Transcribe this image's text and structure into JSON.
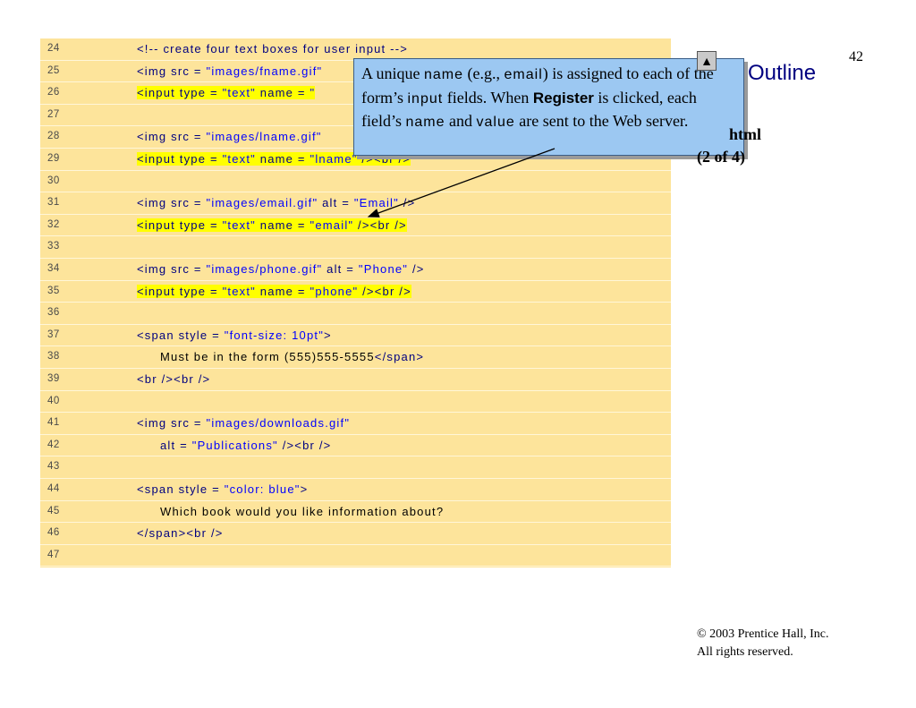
{
  "slide": {
    "number": "42",
    "outline_label": "Outline",
    "nav_up_label": "▲",
    "file_name": "html",
    "file_part": "(2 of 4)",
    "copyright_line1": "©  2003 Prentice Hall, Inc.",
    "copyright_line2": "All rights reserved."
  },
  "callout": {
    "t1": "A unique ",
    "m1": "name",
    "t2": " (e.g., ",
    "m2": "email",
    "t3": ") is assigned to each of the form’s ",
    "m3": "input",
    "t4": " fields. When ",
    "b1": "Register",
    "t5": " is clicked, each field’s ",
    "m4": "name",
    "t6": " and ",
    "m5": "value",
    "t7": " are sent to the Web server."
  },
  "code_lines": [
    {
      "num": "24",
      "indent": 2,
      "hl": false,
      "parts": [
        {
          "t": "<!-- create four text boxes for user input -->",
          "c": ""
        }
      ]
    },
    {
      "num": "25",
      "indent": 2,
      "hl": false,
      "parts": [
        {
          "t": "<img src = ",
          "c": ""
        },
        {
          "t": "\"images/fname.gif\"",
          "c": "val"
        }
      ]
    },
    {
      "num": "26",
      "indent": 2,
      "hl": true,
      "parts": [
        {
          "t": "<input type = ",
          "c": ""
        },
        {
          "t": "\"text\"",
          "c": "val"
        },
        {
          "t": " name = ",
          "c": ""
        },
        {
          "t": "\"",
          "c": "val"
        }
      ]
    },
    {
      "num": "27",
      "indent": 0,
      "hl": false,
      "parts": []
    },
    {
      "num": "28",
      "indent": 2,
      "hl": false,
      "parts": [
        {
          "t": "<img src = ",
          "c": ""
        },
        {
          "t": "\"images/lname.gif\"",
          "c": "val"
        }
      ]
    },
    {
      "num": "29",
      "indent": 2,
      "hl": true,
      "parts": [
        {
          "t": "<input type = ",
          "c": ""
        },
        {
          "t": "\"text\"",
          "c": "val"
        },
        {
          "t": " name = ",
          "c": ""
        },
        {
          "t": "\"lname\"",
          "c": "val"
        },
        {
          "t": " /><br />",
          "c": ""
        }
      ]
    },
    {
      "num": "30",
      "indent": 0,
      "hl": false,
      "parts": []
    },
    {
      "num": "31",
      "indent": 2,
      "hl": false,
      "parts": [
        {
          "t": "<img src = ",
          "c": ""
        },
        {
          "t": "\"images/email.gif\"",
          "c": "val"
        },
        {
          "t": " alt = ",
          "c": ""
        },
        {
          "t": "\"Email\"",
          "c": "val"
        },
        {
          "t": " />",
          "c": ""
        }
      ]
    },
    {
      "num": "32",
      "indent": 2,
      "hl": true,
      "parts": [
        {
          "t": "<input type = ",
          "c": ""
        },
        {
          "t": "\"text\"",
          "c": "val"
        },
        {
          "t": " name = ",
          "c": ""
        },
        {
          "t": "\"email\"",
          "c": "val"
        },
        {
          "t": " /><br />",
          "c": ""
        }
      ]
    },
    {
      "num": "33",
      "indent": 0,
      "hl": false,
      "parts": []
    },
    {
      "num": "34",
      "indent": 2,
      "hl": false,
      "parts": [
        {
          "t": "<img src = ",
          "c": ""
        },
        {
          "t": "\"images/phone.gif\"",
          "c": "val"
        },
        {
          "t": " alt = ",
          "c": ""
        },
        {
          "t": "\"Phone\"",
          "c": "val"
        },
        {
          "t": " />",
          "c": ""
        }
      ]
    },
    {
      "num": "35",
      "indent": 2,
      "hl": true,
      "parts": [
        {
          "t": "<input type = ",
          "c": ""
        },
        {
          "t": "\"text\"",
          "c": "val"
        },
        {
          "t": " name = ",
          "c": ""
        },
        {
          "t": "\"phone\"",
          "c": "val"
        },
        {
          "t": " /><br />",
          "c": ""
        }
      ]
    },
    {
      "num": "36",
      "indent": 0,
      "hl": false,
      "parts": []
    },
    {
      "num": "37",
      "indent": 2,
      "hl": false,
      "parts": [
        {
          "t": "<span style = ",
          "c": ""
        },
        {
          "t": "\"font-size: 10pt\"",
          "c": "val"
        },
        {
          "t": ">",
          "c": ""
        }
      ]
    },
    {
      "num": "38",
      "indent": 3,
      "hl": false,
      "parts": [
        {
          "t": "Must be in the form (555)555-5555",
          "c": "plain"
        },
        {
          "t": "</span>",
          "c": ""
        }
      ]
    },
    {
      "num": "39",
      "indent": 2,
      "hl": false,
      "parts": [
        {
          "t": "<br /><br />",
          "c": ""
        }
      ]
    },
    {
      "num": "40",
      "indent": 0,
      "hl": false,
      "parts": []
    },
    {
      "num": "41",
      "indent": 2,
      "hl": false,
      "parts": [
        {
          "t": "<img src = ",
          "c": ""
        },
        {
          "t": "\"images/downloads.gif\"",
          "c": "val"
        }
      ]
    },
    {
      "num": "42",
      "indent": 3,
      "hl": false,
      "parts": [
        {
          "t": "alt = ",
          "c": ""
        },
        {
          "t": "\"Publications\"",
          "c": "val"
        },
        {
          "t": " /><br />",
          "c": ""
        }
      ]
    },
    {
      "num": "43",
      "indent": 0,
      "hl": false,
      "parts": []
    },
    {
      "num": "44",
      "indent": 2,
      "hl": false,
      "parts": [
        {
          "t": "<span style = ",
          "c": ""
        },
        {
          "t": "\"color: blue\"",
          "c": "val"
        },
        {
          "t": ">",
          "c": ""
        }
      ]
    },
    {
      "num": "45",
      "indent": 3,
      "hl": false,
      "parts": [
        {
          "t": "Which book would you like information about?",
          "c": "plain"
        }
      ]
    },
    {
      "num": "46",
      "indent": 2,
      "hl": false,
      "parts": [
        {
          "t": "</span><br />",
          "c": ""
        }
      ]
    },
    {
      "num": "47",
      "indent": 0,
      "hl": false,
      "parts": []
    }
  ]
}
